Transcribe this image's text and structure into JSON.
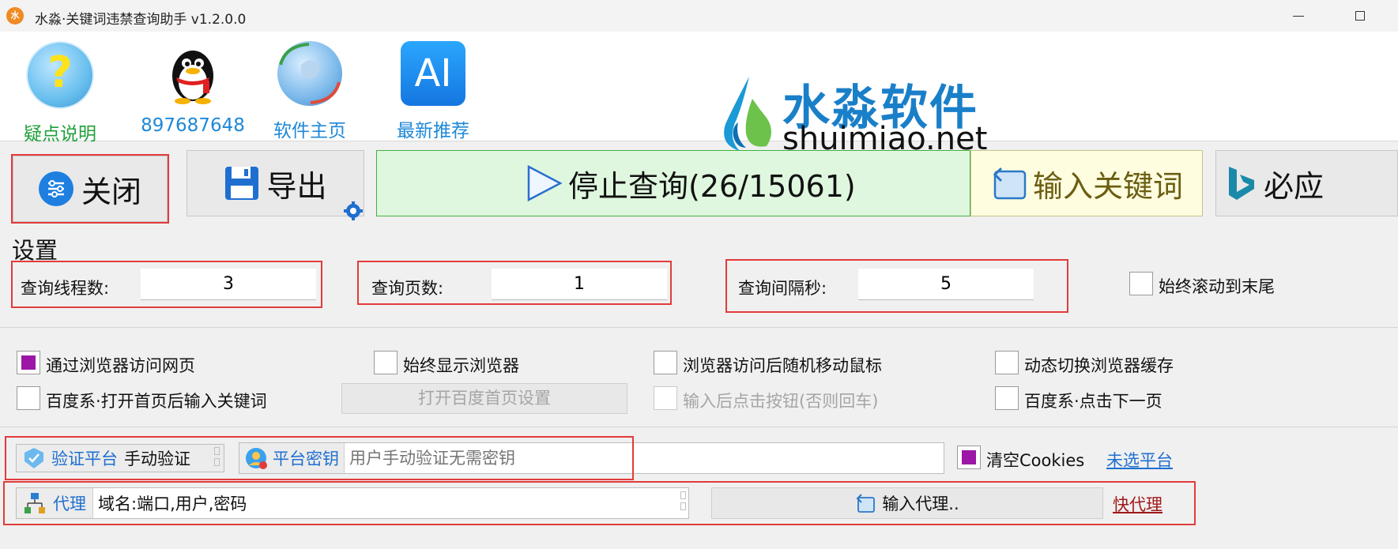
{
  "window": {
    "title": "水淼·关键词违禁查询助手 v1.2.0.0",
    "app_icon_text": "水"
  },
  "top_links": [
    {
      "label": "疑点说明",
      "color": "#21a03a",
      "icon": "help-question-icon"
    },
    {
      "label": "897687648",
      "color": "#1e88d8",
      "icon": "qq-penguin-icon"
    },
    {
      "label": "软件主页",
      "color": "#1e88d8",
      "icon": "globe-icon"
    },
    {
      "label": "最新推荐",
      "color": "#1e88d8",
      "icon": "ai-icon",
      "icon_text": "AI"
    }
  ],
  "logo": {
    "cn": "水淼软件",
    "en": "shuimiao.net"
  },
  "toolbar": {
    "close_label": "关闭",
    "export_label": "导出",
    "stop_query_label": "停止查询(26/15061)",
    "input_keywords_label": "输入关键词",
    "engine_label": "必应"
  },
  "settings": {
    "title": "设置",
    "threads_label": "查询线程数:",
    "threads_value": "3",
    "pages_label": "查询页数:",
    "pages_value": "1",
    "interval_label": "查询间隔秒:",
    "interval_value": "5",
    "scroll_to_end_label": "始终滚动到末尾"
  },
  "options": {
    "via_browser": "通过浏览器访问网页",
    "always_show_browser": "始终显示浏览器",
    "random_mouse": "浏览器访问后随机移动鼠标",
    "switch_cache": "动态切换浏览器缓存",
    "baidu_home_input": "百度系·打开首页后输入关键词",
    "baidu_home_settings": "打开百度首页设置",
    "click_button_after_input": "输入后点击按钮(否则回车)",
    "baidu_next_page": "百度系·点击下一页"
  },
  "verify": {
    "platform_label": "验证平台",
    "platform_value": "手动验证",
    "key_label": "平台密钥",
    "key_placeholder": "用户手动验证无需密钥",
    "clear_cookies_label": "清空Cookies",
    "no_platform_link": "未选平台"
  },
  "proxy": {
    "label": "代理",
    "value": "域名:端口,用户,密码",
    "input_proxy_label": "输入代理..",
    "fast_proxy_link": "快代理"
  },
  "colors": {
    "accent_red": "#e23b3b",
    "checked_purple": "#9c17a6",
    "link_blue": "#1f6fd0",
    "stop_green_bg": "#dff7de",
    "keyword_yellow_bg": "#fffde0"
  }
}
